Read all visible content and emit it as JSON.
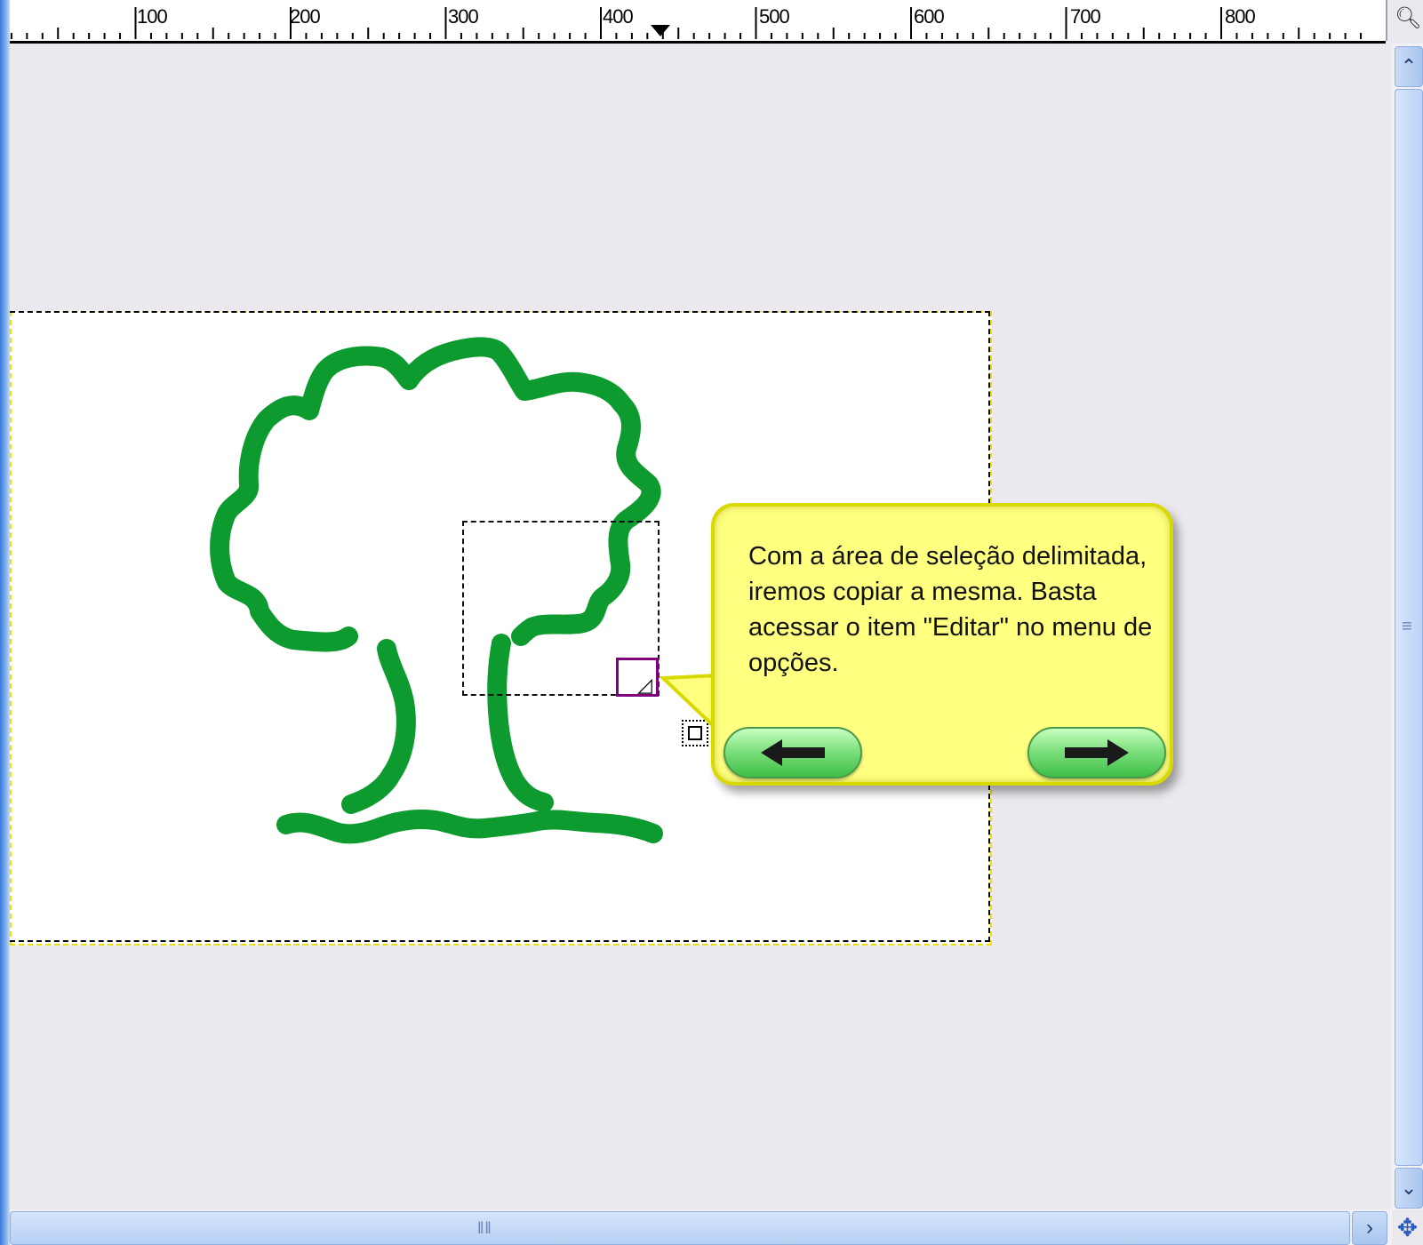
{
  "ruler": {
    "labels": [
      "100",
      "200",
      "300",
      "400",
      "500",
      "600",
      "700",
      "800"
    ],
    "corner_icon": "zoom-icon"
  },
  "tooltip": {
    "text": "Com a área de seleção delimitada, iremos copiar a mesma. Basta acessar o item \"Editar\" no menu de opções.",
    "prev_icon": "arrow-left-icon",
    "next_icon": "arrow-right-icon",
    "background": "#ffff80"
  },
  "canvas": {
    "stroke_color": "#0d9a2e",
    "background": "#ebe9ed",
    "image_background": "#ffffff"
  },
  "scrollbars": {
    "up_icon": "chevron-up-icon",
    "down_icon": "chevron-down-icon",
    "right_icon": "chevron-right-icon",
    "navigate_icon": "move-icon"
  }
}
